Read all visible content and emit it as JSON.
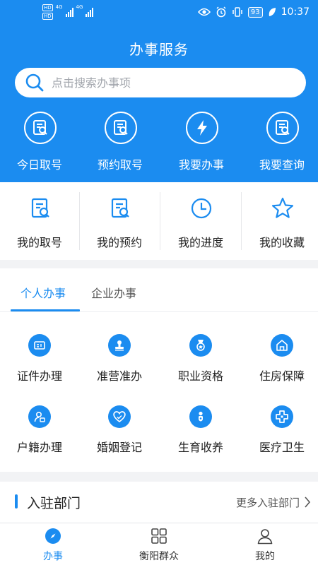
{
  "status_bar": {
    "hd1": "HD",
    "hd2": "HD",
    "net1": "4G",
    "net2": "4G",
    "battery": "93",
    "time": "10:37"
  },
  "header": {
    "title": "办事服务"
  },
  "search": {
    "placeholder": "点击搜索办事项"
  },
  "top_actions": [
    {
      "label": "今日取号",
      "icon": "ticket-search-icon"
    },
    {
      "label": "预约取号",
      "icon": "appointment-icon"
    },
    {
      "label": "我要办事",
      "icon": "lightning-icon"
    },
    {
      "label": "我要查询",
      "icon": "query-icon"
    }
  ],
  "quick_actions": [
    {
      "label": "我的取号",
      "icon": "my-ticket-icon"
    },
    {
      "label": "我的预约",
      "icon": "my-appointment-icon"
    },
    {
      "label": "我的进度",
      "icon": "clock-icon"
    },
    {
      "label": "我的收藏",
      "icon": "star-icon"
    }
  ],
  "tabs": [
    {
      "label": "个人办事",
      "active": true
    },
    {
      "label": "企业办事",
      "active": false
    }
  ],
  "services": [
    {
      "label": "证件办理",
      "icon": "id-card-icon"
    },
    {
      "label": "准营准办",
      "icon": "stamp-icon"
    },
    {
      "label": "职业资格",
      "icon": "medal-icon"
    },
    {
      "label": "住房保障",
      "icon": "house-icon"
    },
    {
      "label": "户籍办理",
      "icon": "household-icon"
    },
    {
      "label": "婚姻登记",
      "icon": "heart-icon"
    },
    {
      "label": "生育收养",
      "icon": "baby-icon"
    },
    {
      "label": "医疗卫生",
      "icon": "medical-cross-icon"
    }
  ],
  "departments": {
    "title": "入驻部门",
    "more": "更多入驻部门"
  },
  "tabbar": [
    {
      "label": "办事",
      "icon": "compass-icon",
      "active": true
    },
    {
      "label": "衡阳群众",
      "icon": "grid-icon",
      "active": false
    },
    {
      "label": "我的",
      "icon": "person-icon",
      "active": false
    }
  ],
  "colors": {
    "primary": "#1b8cf0",
    "background": "#f2f3f5"
  }
}
